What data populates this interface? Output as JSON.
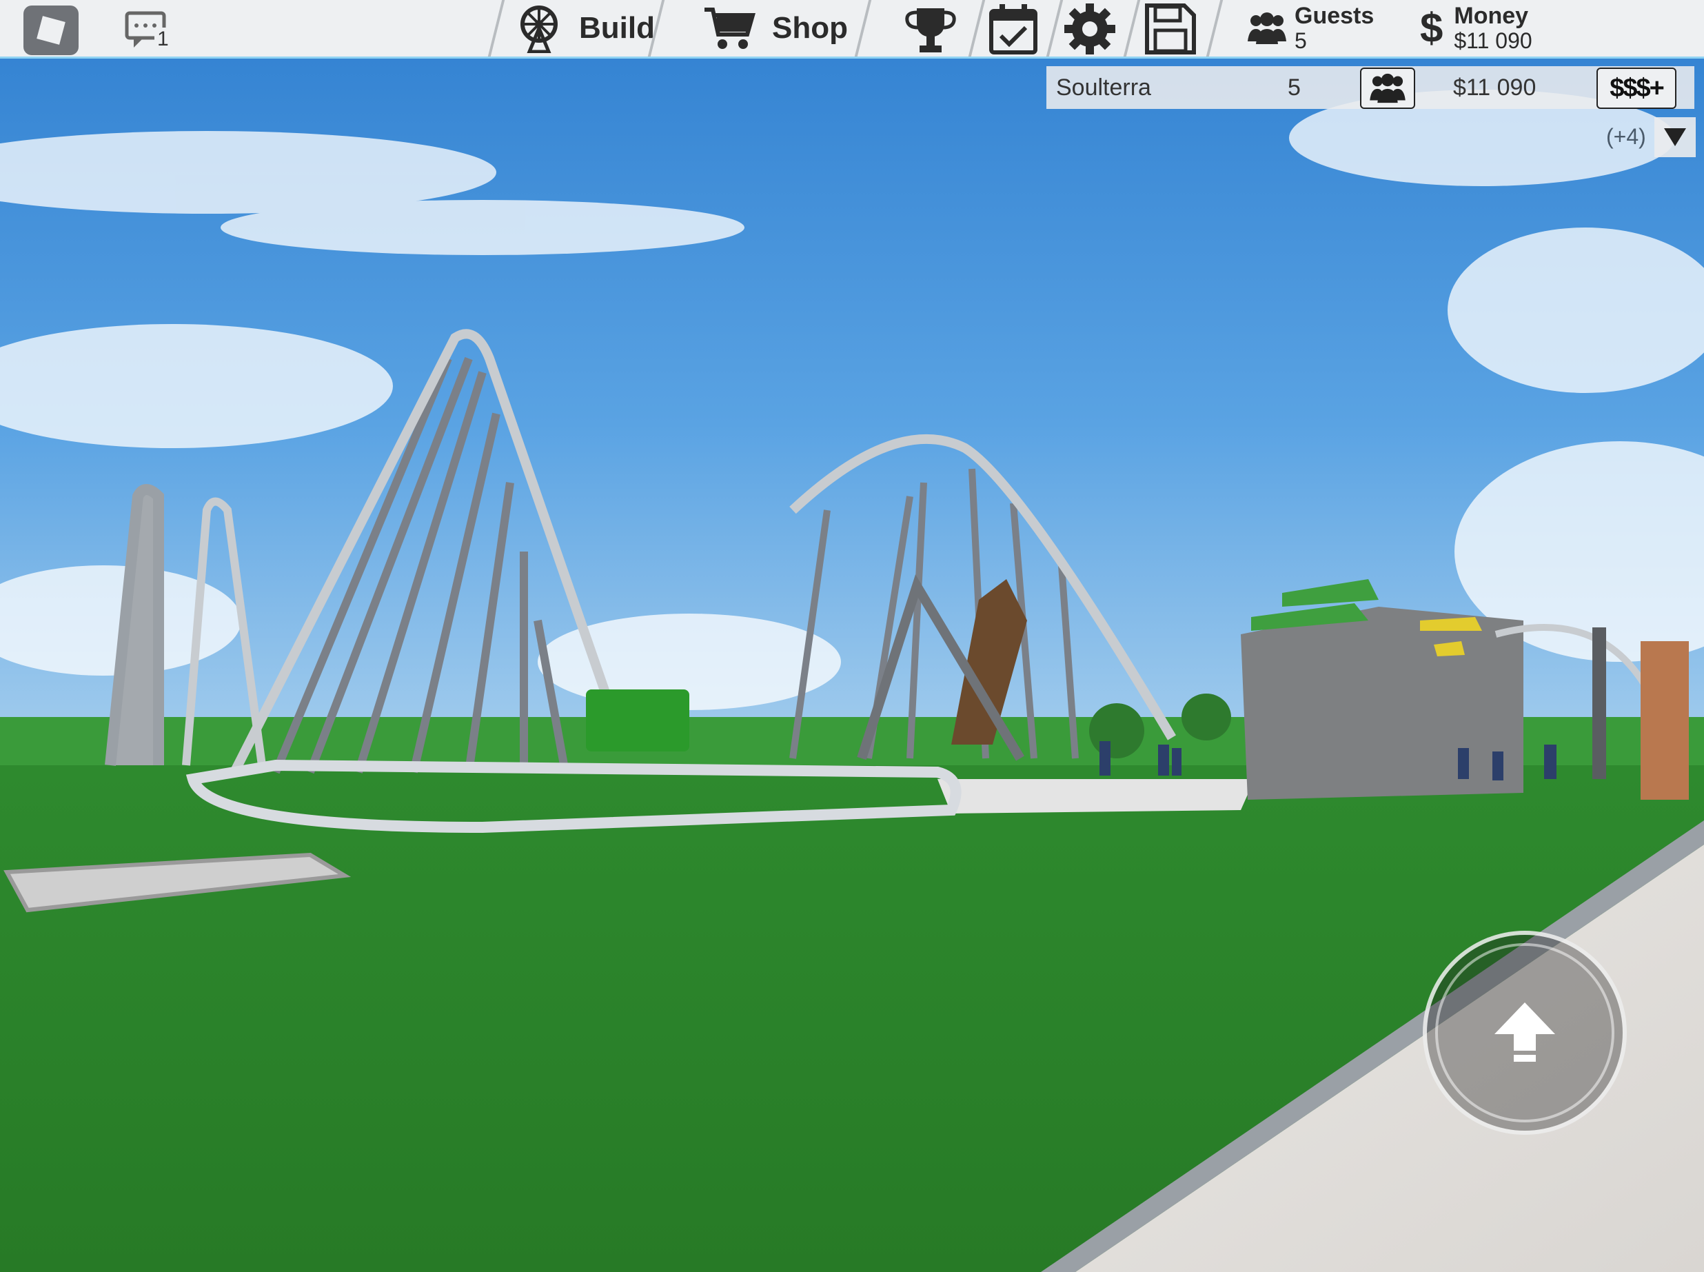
{
  "topbar": {
    "chat_badge_count": "1",
    "build_label": "Build",
    "shop_label": "Shop",
    "guests_label": "Guests",
    "guests_value": "5",
    "money_label": "Money",
    "money_value": "$11 090",
    "icons": [
      "roblox-menu-icon",
      "chat-icon",
      "ferris-wheel-icon",
      "cart-icon",
      "trophy-icon",
      "calendar-check-icon",
      "gear-icon",
      "save-icon",
      "guests-icon",
      "dollar-icon"
    ]
  },
  "player_list": {
    "player_name": "Soulterra",
    "player_guests": "5",
    "player_money": "$11 090",
    "buy_money_label": "$$$+",
    "more_players": "(+4)"
  },
  "colors": {
    "topbar_bg": "#eef0f2",
    "topbar_border": "#8fd3f3",
    "grass": "#2f8b2c",
    "sky": "#3f8fd6"
  }
}
